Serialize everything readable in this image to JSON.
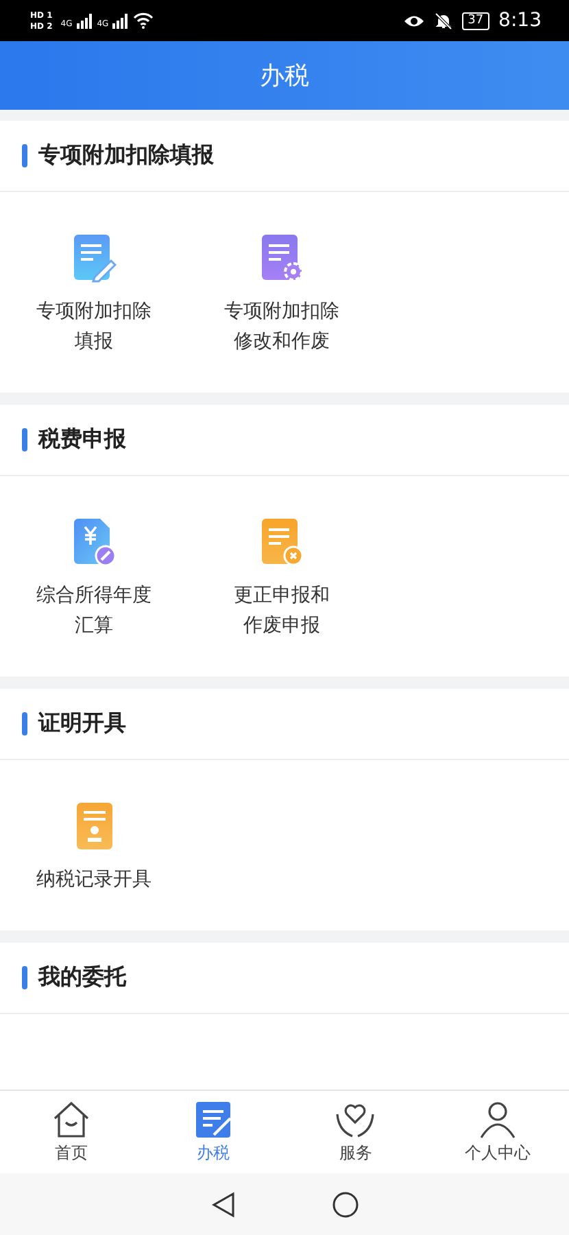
{
  "status_bar": {
    "sims": [
      {
        "hd": "HD",
        "slot": "1",
        "network": "4G"
      },
      {
        "hd": "HD",
        "slot": "2",
        "network": "4G"
      }
    ],
    "battery": "37",
    "time": "8:13"
  },
  "header": {
    "title": "办税"
  },
  "sections": [
    {
      "title": "专项附加扣除填报",
      "items": [
        {
          "kind": "edit",
          "lines": [
            "专项附加扣除",
            "填报"
          ]
        },
        {
          "kind": "modify",
          "lines": [
            "专项附加扣除",
            "修改和作废"
          ]
        }
      ]
    },
    {
      "title": "税费申报",
      "items": [
        {
          "kind": "annual",
          "lines": [
            "综合所得年度",
            "汇算"
          ]
        },
        {
          "kind": "void",
          "lines": [
            "更正申报和",
            "作废申报"
          ]
        }
      ]
    },
    {
      "title": "证明开具",
      "items": [
        {
          "kind": "record",
          "lines": [
            "纳税记录开具"
          ]
        }
      ]
    },
    {
      "title": "我的委托"
    }
  ],
  "tabs": [
    {
      "kind": "home",
      "label": "首页",
      "selected": false
    },
    {
      "kind": "tax",
      "label": "办税",
      "selected": true
    },
    {
      "kind": "service",
      "label": "服务",
      "selected": false
    },
    {
      "kind": "profile",
      "label": "个人中心",
      "selected": false
    }
  ]
}
